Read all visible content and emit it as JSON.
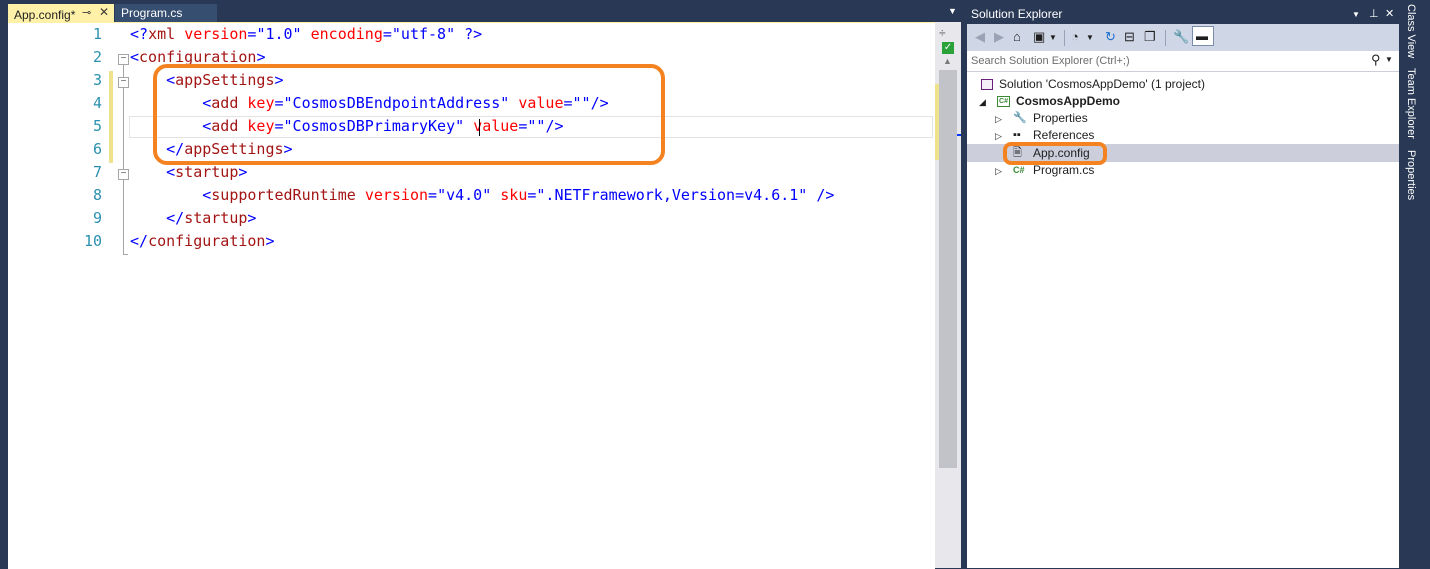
{
  "tabs": [
    {
      "label": "App.config*",
      "active": true
    },
    {
      "label": "Program.cs",
      "active": false
    }
  ],
  "editor": {
    "lines": [
      {
        "num": "1",
        "tokens": [
          {
            "c": "br",
            "t": "<?"
          },
          {
            "c": "tag",
            "t": "xml"
          },
          {
            "c": "sp",
            "t": " "
          },
          {
            "c": "attr",
            "t": "version"
          },
          {
            "c": "eq",
            "t": "="
          },
          {
            "c": "val",
            "t": "\"1.0\""
          },
          {
            "c": "sp",
            "t": " "
          },
          {
            "c": "attr",
            "t": "encoding"
          },
          {
            "c": "eq",
            "t": "="
          },
          {
            "c": "val",
            "t": "\"utf-8\""
          },
          {
            "c": "sp",
            "t": " "
          },
          {
            "c": "br",
            "t": "?>"
          }
        ]
      },
      {
        "num": "2",
        "tokens": [
          {
            "c": "br",
            "t": "<"
          },
          {
            "c": "tag",
            "t": "configuration"
          },
          {
            "c": "br",
            "t": ">"
          }
        ]
      },
      {
        "num": "3",
        "tokens": [
          {
            "c": "sp",
            "t": "    "
          },
          {
            "c": "br",
            "t": "<"
          },
          {
            "c": "tag",
            "t": "appSettings"
          },
          {
            "c": "br",
            "t": ">"
          }
        ]
      },
      {
        "num": "4",
        "tokens": [
          {
            "c": "sp",
            "t": "        "
          },
          {
            "c": "br",
            "t": "<"
          },
          {
            "c": "tag",
            "t": "add"
          },
          {
            "c": "sp",
            "t": " "
          },
          {
            "c": "attr",
            "t": "key"
          },
          {
            "c": "eq",
            "t": "="
          },
          {
            "c": "val",
            "t": "\"CosmosDBEndpointAddress\""
          },
          {
            "c": "sp",
            "t": " "
          },
          {
            "c": "attr",
            "t": "value"
          },
          {
            "c": "eq",
            "t": "="
          },
          {
            "c": "val",
            "t": "\"\""
          },
          {
            "c": "br",
            "t": "/>"
          }
        ]
      },
      {
        "num": "5",
        "tokens": [
          {
            "c": "sp",
            "t": "        "
          },
          {
            "c": "br",
            "t": "<"
          },
          {
            "c": "tag",
            "t": "add"
          },
          {
            "c": "sp",
            "t": " "
          },
          {
            "c": "attr",
            "t": "key"
          },
          {
            "c": "eq",
            "t": "="
          },
          {
            "c": "val",
            "t": "\"CosmosDBPrimaryKey\""
          },
          {
            "c": "sp",
            "t": " "
          },
          {
            "c": "attr",
            "t": "value"
          },
          {
            "c": "eq",
            "t": "="
          },
          {
            "c": "val",
            "t": "\"\""
          },
          {
            "c": "br",
            "t": "/>"
          }
        ]
      },
      {
        "num": "6",
        "tokens": [
          {
            "c": "sp",
            "t": "    "
          },
          {
            "c": "br",
            "t": "</"
          },
          {
            "c": "tag",
            "t": "appSettings"
          },
          {
            "c": "br",
            "t": ">"
          }
        ]
      },
      {
        "num": "7",
        "tokens": [
          {
            "c": "sp",
            "t": "    "
          },
          {
            "c": "br",
            "t": "<"
          },
          {
            "c": "tag",
            "t": "startup"
          },
          {
            "c": "br",
            "t": ">"
          }
        ]
      },
      {
        "num": "8",
        "tokens": [
          {
            "c": "sp",
            "t": "        "
          },
          {
            "c": "br",
            "t": "<"
          },
          {
            "c": "tag",
            "t": "supportedRuntime"
          },
          {
            "c": "sp",
            "t": " "
          },
          {
            "c": "attr",
            "t": "version"
          },
          {
            "c": "eq",
            "t": "="
          },
          {
            "c": "val",
            "t": "\"v4.0\""
          },
          {
            "c": "sp",
            "t": " "
          },
          {
            "c": "attr",
            "t": "sku"
          },
          {
            "c": "eq",
            "t": "="
          },
          {
            "c": "val",
            "t": "\".NETFramework,Version=v4.6.1\""
          },
          {
            "c": "sp",
            "t": " "
          },
          {
            "c": "br",
            "t": "/>"
          }
        ]
      },
      {
        "num": "9",
        "tokens": [
          {
            "c": "sp",
            "t": "    "
          },
          {
            "c": "br",
            "t": "</"
          },
          {
            "c": "tag",
            "t": "startup"
          },
          {
            "c": "br",
            "t": ">"
          }
        ]
      },
      {
        "num": "10",
        "tokens": [
          {
            "c": "br",
            "t": "</"
          },
          {
            "c": "tag",
            "t": "configuration"
          },
          {
            "c": "br",
            "t": ">"
          }
        ]
      }
    ]
  },
  "solution_explorer": {
    "title": "Solution Explorer",
    "search_placeholder": "Search Solution Explorer (Ctrl+;)",
    "items": [
      {
        "label": "Solution 'CosmosAppDemo' (1 project)"
      },
      {
        "label": "CosmosAppDemo"
      },
      {
        "label": "Properties"
      },
      {
        "label": "References"
      },
      {
        "label": "App.config"
      },
      {
        "label": "Program.cs"
      }
    ]
  },
  "side_tabs": [
    "Class View",
    "Team Explorer",
    "Properties"
  ],
  "colors": {
    "accent": "#f58220",
    "chrome": "#293955",
    "active_tab": "#fff1a8"
  }
}
